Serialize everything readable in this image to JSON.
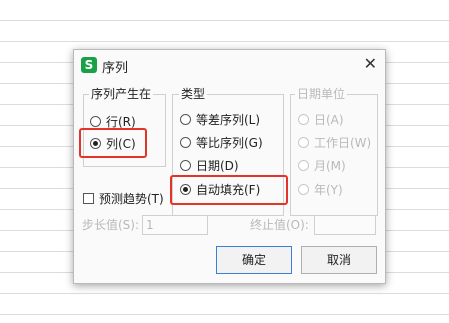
{
  "dialog": {
    "title": "序列",
    "app_icon": "S",
    "close_glyph": "✕"
  },
  "series_in": {
    "label": "序列产生在",
    "options": [
      {
        "label": "行(R)",
        "checked": false
      },
      {
        "label": "列(C)",
        "checked": true
      }
    ]
  },
  "type": {
    "label": "类型",
    "options": [
      {
        "label": "等差序列(L)",
        "checked": false
      },
      {
        "label": "等比序列(G)",
        "checked": false
      },
      {
        "label": "日期(D)",
        "checked": false
      },
      {
        "label": "自动填充(F)",
        "checked": true
      }
    ]
  },
  "date_unit": {
    "label": "日期单位",
    "options": [
      {
        "label": "日(A)",
        "checked": false
      },
      {
        "label": "工作日(W)",
        "checked": false
      },
      {
        "label": "月(M)",
        "checked": false
      },
      {
        "label": "年(Y)",
        "checked": false
      }
    ]
  },
  "trend": {
    "label": "预测趋势(T)",
    "checked": false
  },
  "step": {
    "label": "步长值(S):",
    "value": "1"
  },
  "stop": {
    "label": "终止值(O):",
    "value": ""
  },
  "buttons": {
    "ok": "确定",
    "cancel": "取消"
  },
  "colors": {
    "highlight": "#e4342a",
    "app_icon": "#1aa148",
    "primary_border": "#3b7fd6"
  }
}
